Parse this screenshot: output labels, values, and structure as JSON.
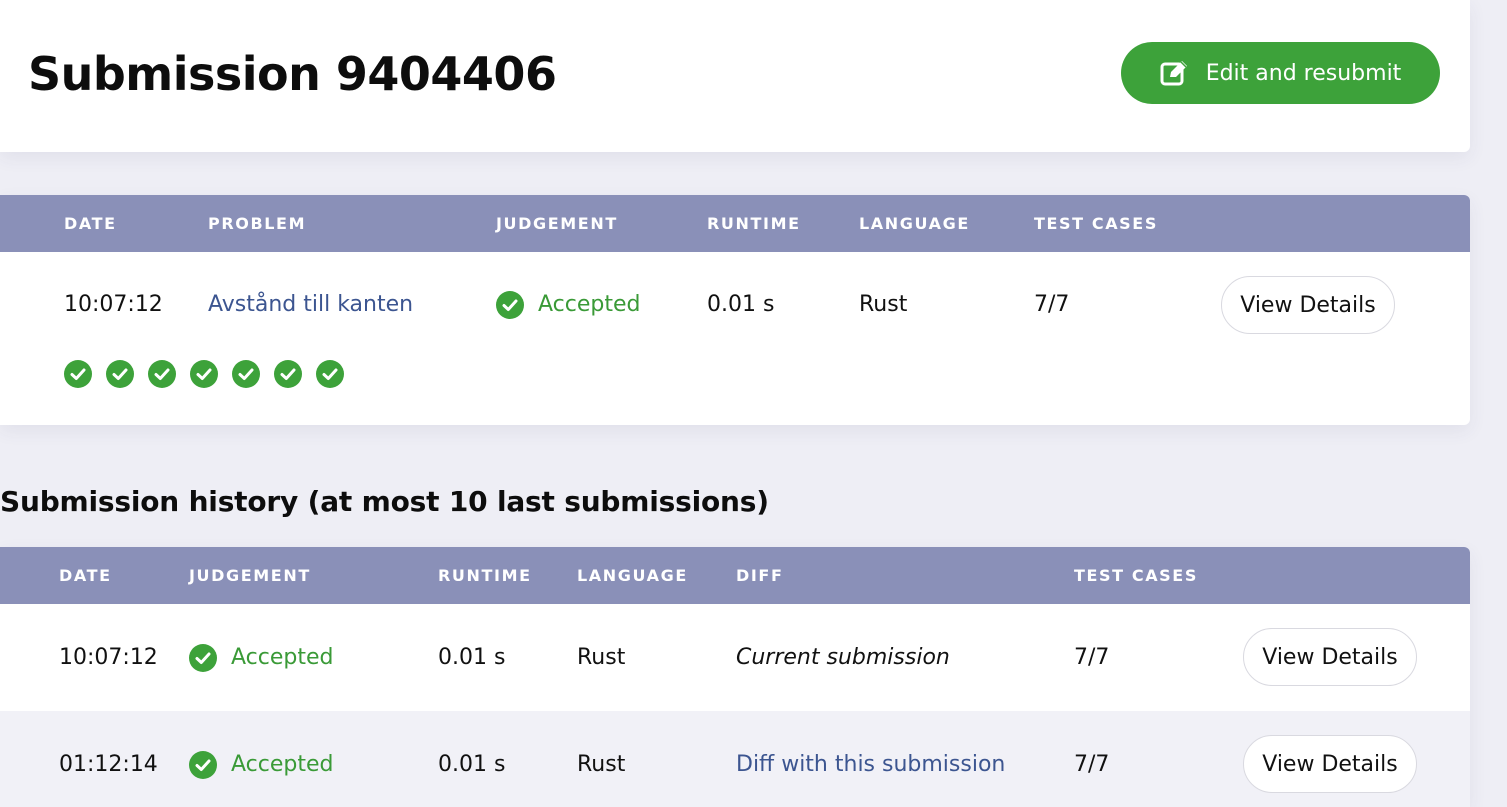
{
  "header": {
    "title": "Submission 9404406",
    "resubmit_label": "Edit and resubmit"
  },
  "submission": {
    "columns": [
      "DATE",
      "PROBLEM",
      "JUDGEMENT",
      "RUNTIME",
      "LANGUAGE",
      "TEST CASES"
    ],
    "row": {
      "date": "10:07:12",
      "problem": "Avstånd till kanten",
      "judgement": "Accepted",
      "runtime": "0.01 s",
      "language": "Rust",
      "test_cases": "7/7",
      "details_label": "View Details"
    },
    "test_case_results": [
      "accepted",
      "accepted",
      "accepted",
      "accepted",
      "accepted",
      "accepted",
      "accepted"
    ]
  },
  "history": {
    "title": "Submission history (at most 10 last submissions)",
    "columns": [
      "DATE",
      "JUDGEMENT",
      "RUNTIME",
      "LANGUAGE",
      "DIFF",
      "TEST CASES"
    ],
    "rows": [
      {
        "date": "10:07:12",
        "judgement": "Accepted",
        "runtime": "0.01 s",
        "language": "Rust",
        "diff": "Current submission",
        "test_cases": "7/7",
        "details_label": "View Details"
      },
      {
        "date": "01:12:14",
        "judgement": "Accepted",
        "runtime": "0.01 s",
        "language": "Rust",
        "diff": "Diff with this submission",
        "test_cases": "7/7",
        "details_label": "View Details"
      }
    ]
  },
  "colors": {
    "accent_green": "#3da23a",
    "accepted_text": "#3a9a37",
    "table_header": "#8a90b8",
    "link": "#3c5590",
    "page_background": "#eeeef5"
  },
  "icons": {
    "resubmit": "edit-icon",
    "accepted": "check-circle-icon"
  }
}
